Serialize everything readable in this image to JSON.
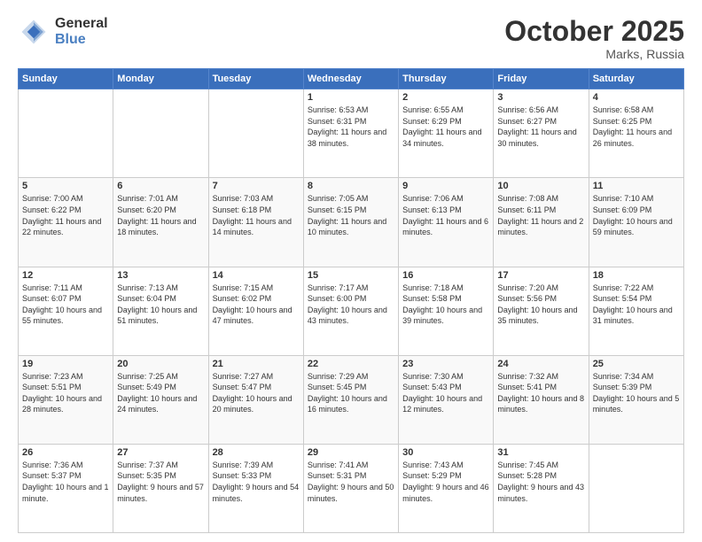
{
  "header": {
    "logo_general": "General",
    "logo_blue": "Blue",
    "month": "October 2025",
    "location": "Marks, Russia"
  },
  "weekdays": [
    "Sunday",
    "Monday",
    "Tuesday",
    "Wednesday",
    "Thursday",
    "Friday",
    "Saturday"
  ],
  "weeks": [
    [
      {
        "day": "",
        "sunrise": "",
        "sunset": "",
        "daylight": "",
        "empty": true
      },
      {
        "day": "",
        "sunrise": "",
        "sunset": "",
        "daylight": "",
        "empty": true
      },
      {
        "day": "",
        "sunrise": "",
        "sunset": "",
        "daylight": "",
        "empty": true
      },
      {
        "day": "1",
        "sunrise": "Sunrise: 6:53 AM",
        "sunset": "Sunset: 6:31 PM",
        "daylight": "Daylight: 11 hours and 38 minutes."
      },
      {
        "day": "2",
        "sunrise": "Sunrise: 6:55 AM",
        "sunset": "Sunset: 6:29 PM",
        "daylight": "Daylight: 11 hours and 34 minutes."
      },
      {
        "day": "3",
        "sunrise": "Sunrise: 6:56 AM",
        "sunset": "Sunset: 6:27 PM",
        "daylight": "Daylight: 11 hours and 30 minutes."
      },
      {
        "day": "4",
        "sunrise": "Sunrise: 6:58 AM",
        "sunset": "Sunset: 6:25 PM",
        "daylight": "Daylight: 11 hours and 26 minutes."
      }
    ],
    [
      {
        "day": "5",
        "sunrise": "Sunrise: 7:00 AM",
        "sunset": "Sunset: 6:22 PM",
        "daylight": "Daylight: 11 hours and 22 minutes."
      },
      {
        "day": "6",
        "sunrise": "Sunrise: 7:01 AM",
        "sunset": "Sunset: 6:20 PM",
        "daylight": "Daylight: 11 hours and 18 minutes."
      },
      {
        "day": "7",
        "sunrise": "Sunrise: 7:03 AM",
        "sunset": "Sunset: 6:18 PM",
        "daylight": "Daylight: 11 hours and 14 minutes."
      },
      {
        "day": "8",
        "sunrise": "Sunrise: 7:05 AM",
        "sunset": "Sunset: 6:15 PM",
        "daylight": "Daylight: 11 hours and 10 minutes."
      },
      {
        "day": "9",
        "sunrise": "Sunrise: 7:06 AM",
        "sunset": "Sunset: 6:13 PM",
        "daylight": "Daylight: 11 hours and 6 minutes."
      },
      {
        "day": "10",
        "sunrise": "Sunrise: 7:08 AM",
        "sunset": "Sunset: 6:11 PM",
        "daylight": "Daylight: 11 hours and 2 minutes."
      },
      {
        "day": "11",
        "sunrise": "Sunrise: 7:10 AM",
        "sunset": "Sunset: 6:09 PM",
        "daylight": "Daylight: 10 hours and 59 minutes."
      }
    ],
    [
      {
        "day": "12",
        "sunrise": "Sunrise: 7:11 AM",
        "sunset": "Sunset: 6:07 PM",
        "daylight": "Daylight: 10 hours and 55 minutes."
      },
      {
        "day": "13",
        "sunrise": "Sunrise: 7:13 AM",
        "sunset": "Sunset: 6:04 PM",
        "daylight": "Daylight: 10 hours and 51 minutes."
      },
      {
        "day": "14",
        "sunrise": "Sunrise: 7:15 AM",
        "sunset": "Sunset: 6:02 PM",
        "daylight": "Daylight: 10 hours and 47 minutes."
      },
      {
        "day": "15",
        "sunrise": "Sunrise: 7:17 AM",
        "sunset": "Sunset: 6:00 PM",
        "daylight": "Daylight: 10 hours and 43 minutes."
      },
      {
        "day": "16",
        "sunrise": "Sunrise: 7:18 AM",
        "sunset": "Sunset: 5:58 PM",
        "daylight": "Daylight: 10 hours and 39 minutes."
      },
      {
        "day": "17",
        "sunrise": "Sunrise: 7:20 AM",
        "sunset": "Sunset: 5:56 PM",
        "daylight": "Daylight: 10 hours and 35 minutes."
      },
      {
        "day": "18",
        "sunrise": "Sunrise: 7:22 AM",
        "sunset": "Sunset: 5:54 PM",
        "daylight": "Daylight: 10 hours and 31 minutes."
      }
    ],
    [
      {
        "day": "19",
        "sunrise": "Sunrise: 7:23 AM",
        "sunset": "Sunset: 5:51 PM",
        "daylight": "Daylight: 10 hours and 28 minutes."
      },
      {
        "day": "20",
        "sunrise": "Sunrise: 7:25 AM",
        "sunset": "Sunset: 5:49 PM",
        "daylight": "Daylight: 10 hours and 24 minutes."
      },
      {
        "day": "21",
        "sunrise": "Sunrise: 7:27 AM",
        "sunset": "Sunset: 5:47 PM",
        "daylight": "Daylight: 10 hours and 20 minutes."
      },
      {
        "day": "22",
        "sunrise": "Sunrise: 7:29 AM",
        "sunset": "Sunset: 5:45 PM",
        "daylight": "Daylight: 10 hours and 16 minutes."
      },
      {
        "day": "23",
        "sunrise": "Sunrise: 7:30 AM",
        "sunset": "Sunset: 5:43 PM",
        "daylight": "Daylight: 10 hours and 12 minutes."
      },
      {
        "day": "24",
        "sunrise": "Sunrise: 7:32 AM",
        "sunset": "Sunset: 5:41 PM",
        "daylight": "Daylight: 10 hours and 8 minutes."
      },
      {
        "day": "25",
        "sunrise": "Sunrise: 7:34 AM",
        "sunset": "Sunset: 5:39 PM",
        "daylight": "Daylight: 10 hours and 5 minutes."
      }
    ],
    [
      {
        "day": "26",
        "sunrise": "Sunrise: 7:36 AM",
        "sunset": "Sunset: 5:37 PM",
        "daylight": "Daylight: 10 hours and 1 minute."
      },
      {
        "day": "27",
        "sunrise": "Sunrise: 7:37 AM",
        "sunset": "Sunset: 5:35 PM",
        "daylight": "Daylight: 9 hours and 57 minutes."
      },
      {
        "day": "28",
        "sunrise": "Sunrise: 7:39 AM",
        "sunset": "Sunset: 5:33 PM",
        "daylight": "Daylight: 9 hours and 54 minutes."
      },
      {
        "day": "29",
        "sunrise": "Sunrise: 7:41 AM",
        "sunset": "Sunset: 5:31 PM",
        "daylight": "Daylight: 9 hours and 50 minutes."
      },
      {
        "day": "30",
        "sunrise": "Sunrise: 7:43 AM",
        "sunset": "Sunset: 5:29 PM",
        "daylight": "Daylight: 9 hours and 46 minutes."
      },
      {
        "day": "31",
        "sunrise": "Sunrise: 7:45 AM",
        "sunset": "Sunset: 5:28 PM",
        "daylight": "Daylight: 9 hours and 43 minutes."
      },
      {
        "day": "",
        "sunrise": "",
        "sunset": "",
        "daylight": "",
        "empty": true
      }
    ]
  ]
}
